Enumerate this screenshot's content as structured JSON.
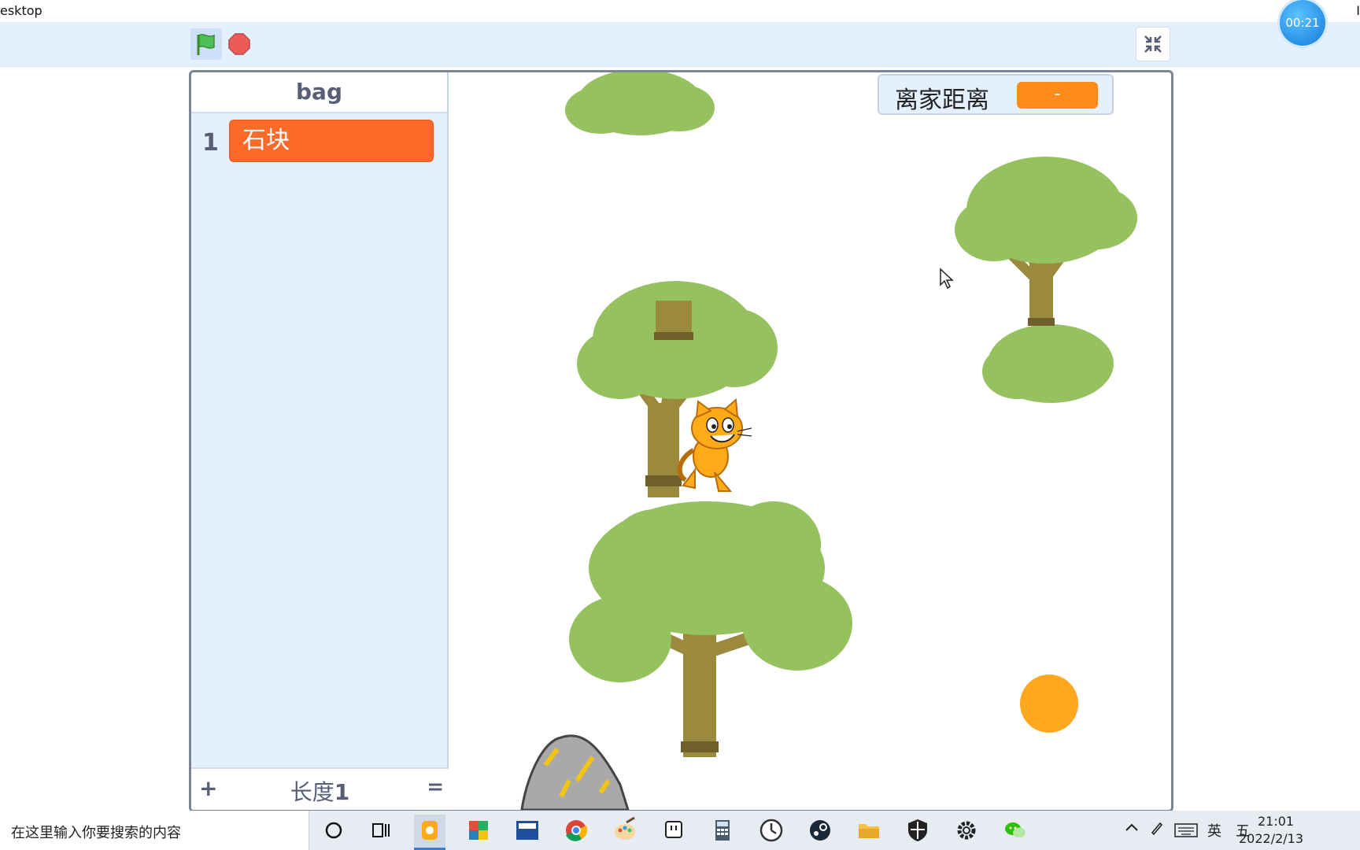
{
  "window": {
    "title": "esktop",
    "right_edge_text": "I"
  },
  "timer": {
    "label": "00:21"
  },
  "list_monitor": {
    "title": "bag",
    "items": [
      {
        "index": "1",
        "value": "石块"
      }
    ],
    "add_label": "+",
    "length_prefix": "长度",
    "length_value": "1",
    "resize_label": "="
  },
  "variable_monitor": {
    "label": "离家距离",
    "value": "-"
  },
  "stage_sprites": [
    "cat-sprite",
    "tree-sprite",
    "bush-sprite",
    "rock-sprite",
    "orange-ball-sprite"
  ],
  "colors": {
    "accent_orange": "#ff6a2b",
    "variable_orange": "#ff8c1a",
    "tree_green": "#95c15f",
    "trunk_brown": "#9b8a3d",
    "ball": "#ffa81f"
  },
  "taskbar": {
    "search_placeholder": "在这里输入你要搜索的内容",
    "apps": [
      "cortana-icon",
      "task-view-icon",
      "scratch-icon",
      "office-icon",
      "dev-cpp-icon",
      "chrome-icon",
      "paint-icon",
      "twitch-icon",
      "calculator-icon",
      "clock-icon",
      "steam-icon",
      "file-explorer-icon",
      "security-icon",
      "settings-icon",
      "wechat-icon"
    ],
    "tray": {
      "ime_lang": "英",
      "ime_mode": "五"
    },
    "time": "21:01",
    "date": "2022/2/13"
  }
}
